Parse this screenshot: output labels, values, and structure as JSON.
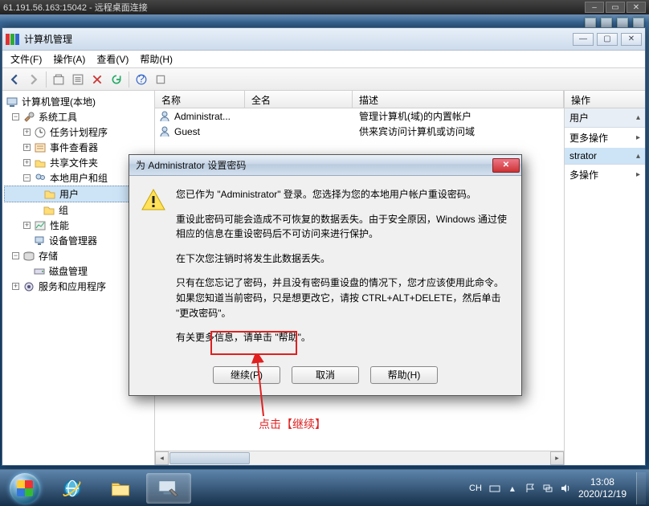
{
  "rdp": {
    "title": "61.191.56.163:15042 - 远程桌面连接"
  },
  "mmc": {
    "title": "计算机管理",
    "menu": {
      "file": "文件(F)",
      "action": "操作(A)",
      "view": "查看(V)",
      "help": "帮助(H)"
    }
  },
  "tree": {
    "root": "计算机管理(本地)",
    "n1": "系统工具",
    "n1a": "任务计划程序",
    "n1b": "事件查看器",
    "n1c": "共享文件夹",
    "n1d": "本地用户和组",
    "n1d1": "用户",
    "n1d2": "组",
    "n1e": "性能",
    "n1f": "设备管理器",
    "n2": "存储",
    "n2a": "磁盘管理",
    "n3": "服务和应用程序"
  },
  "mid": {
    "col1": "名称",
    "col2": "全名",
    "col3": "描述",
    "r1": {
      "name": "Administrat...",
      "desc": "管理计算机(域)的内置帐户"
    },
    "r2": {
      "name": "Guest",
      "desc": "供来宾访问计算机或访问域"
    }
  },
  "right": {
    "head": "操作",
    "s1": {
      "title": "用户",
      "item": "更多操作"
    },
    "s2": {
      "title": "strator",
      "item": "多操作"
    }
  },
  "dlg": {
    "title": "为 Administrator 设置密码",
    "p1": "您已作为 \"Administrator\" 登录。您选择为您的本地用户帐户重设密码。",
    "p2": "重设此密码可能会造成不可恢复的数据丢失。由于安全原因，Windows 通过使相应的信息在重设密码后不可访问来进行保护。",
    "p3": "在下次您注销时将发生此数据丢失。",
    "p4": "只有在您忘记了密码，并且没有密码重设盘的情况下，您才应该使用此命令。如果您知道当前密码，只是想更改它，请按 CTRL+ALT+DELETE，然后单击 \"更改密码\"。",
    "p5": "有关更多信息，请单击 \"帮助\"。",
    "btn_continue": "继续(P)",
    "btn_cancel": "取消",
    "btn_help": "帮助(H)"
  },
  "anno": "点击【继续】",
  "taskbar": {
    "ime": "CH",
    "time": "13:08",
    "date": "2020/12/19"
  }
}
